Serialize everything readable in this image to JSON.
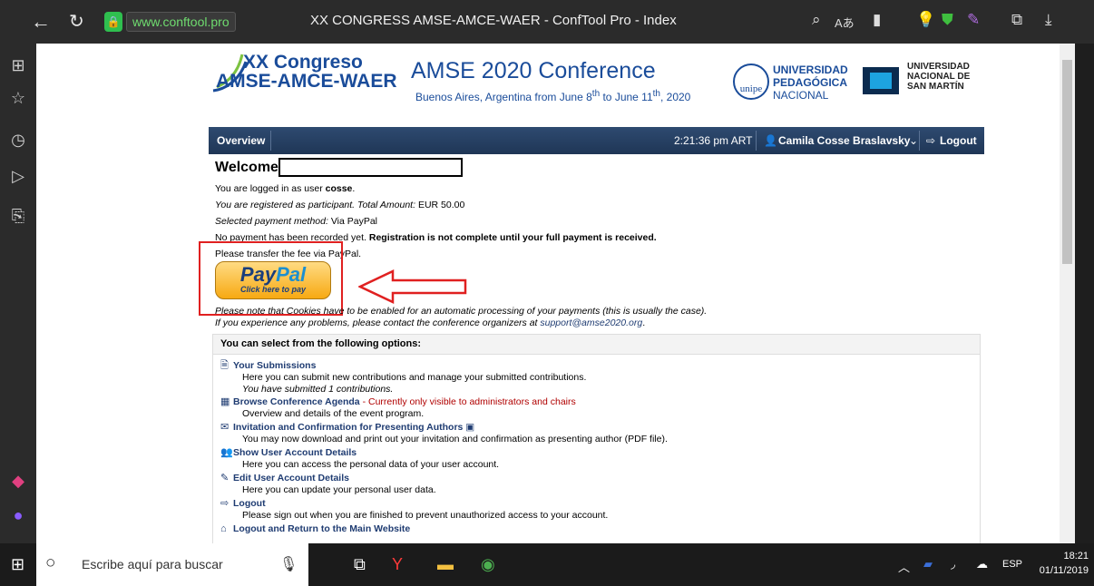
{
  "browser": {
    "url": "www.conftool.pro",
    "title": "XX CONGRESS AMSE-AMCE-WAER - ConfTool Pro - Index"
  },
  "header": {
    "logo_line1": "XX Congreso",
    "logo_line2": "AMSE-AMCE-WAER",
    "conf_title": "AMSE 2020 Conference",
    "conf_sub_a": "Buenos Aires, Argentina from June 8",
    "conf_sub_sup1": "th",
    "conf_sub_b": " to June 11",
    "conf_sub_sup2": "th",
    "conf_sub_c": ", 2020",
    "unipe_badge": "unipe",
    "unipe_line1": "UNIVERSIDAD",
    "unipe_line2": "PEDAGÓGICA",
    "unipe_line3": "NACIONAL",
    "unsam_line1": "UNIVERSIDAD",
    "unsam_line2": "NACIONAL DE",
    "unsam_line3": "SAN MARTÍN"
  },
  "navbar": {
    "overview": "Overview",
    "time": "2:21:36 pm ART",
    "user": "Camila Cosse Braslavsky",
    "logout": "Logout"
  },
  "main": {
    "welcome": "Welcome",
    "logged_in_prefix": "You are logged in as user ",
    "username": "cosse",
    "registered": "You are registered as participant. Total Amount:",
    "amount": "EUR 50.00",
    "payment_method_label": "Selected payment method:",
    "payment_method": "Via PayPal",
    "no_payment": "No payment has been recorded yet. ",
    "no_payment_bold": "Registration is not complete until your full payment is received.",
    "transfer": "Please transfer the fee via PayPal.",
    "paypal_pay": "Pay",
    "paypal_pal": "Pal",
    "paypal_sub": "Click here to pay",
    "cookies_note": "Please note that Cookies have to be enabled for an automatic processing of your payments (this is usually the case).",
    "problems_note": "If you experience any problems, please contact the conference organizers at ",
    "support_email": "support@amse2020.org"
  },
  "options": {
    "heading": "You can select from the following options:",
    "items": [
      {
        "title": "Your Submissions",
        "desc": "Here you can submit new contributions and manage your submitted contributions.",
        "desc2": "You have submitted 1 contributions."
      },
      {
        "title": "Browse Conference Agenda",
        "note": " - Currently only visible to administrators and chairs",
        "desc": "Overview and details of the event program."
      },
      {
        "title": "Invitation and Confirmation for Presenting Authors",
        "desc": "You may now download and print out your invitation and confirmation as presenting author (PDF file)."
      },
      {
        "title": "Show User Account Details",
        "desc": "Here you can access the personal data of your user account."
      },
      {
        "title": "Edit User Account Details",
        "desc": "Here you can update your personal user data."
      },
      {
        "title": "Logout",
        "desc": "Please sign out when you are finished to prevent unauthorized access to your account."
      },
      {
        "title": "Logout and Return to the Main Website"
      }
    ]
  },
  "taskbar": {
    "search_placeholder": "Escribe aquí para buscar",
    "lang": "ESP",
    "time": "18:21",
    "date": "01/11/2019"
  },
  "colors": {
    "navbar": "#1f3656",
    "link": "#1f3c72",
    "highlight": "#e02020",
    "paypal_gold": "#f7a912"
  }
}
